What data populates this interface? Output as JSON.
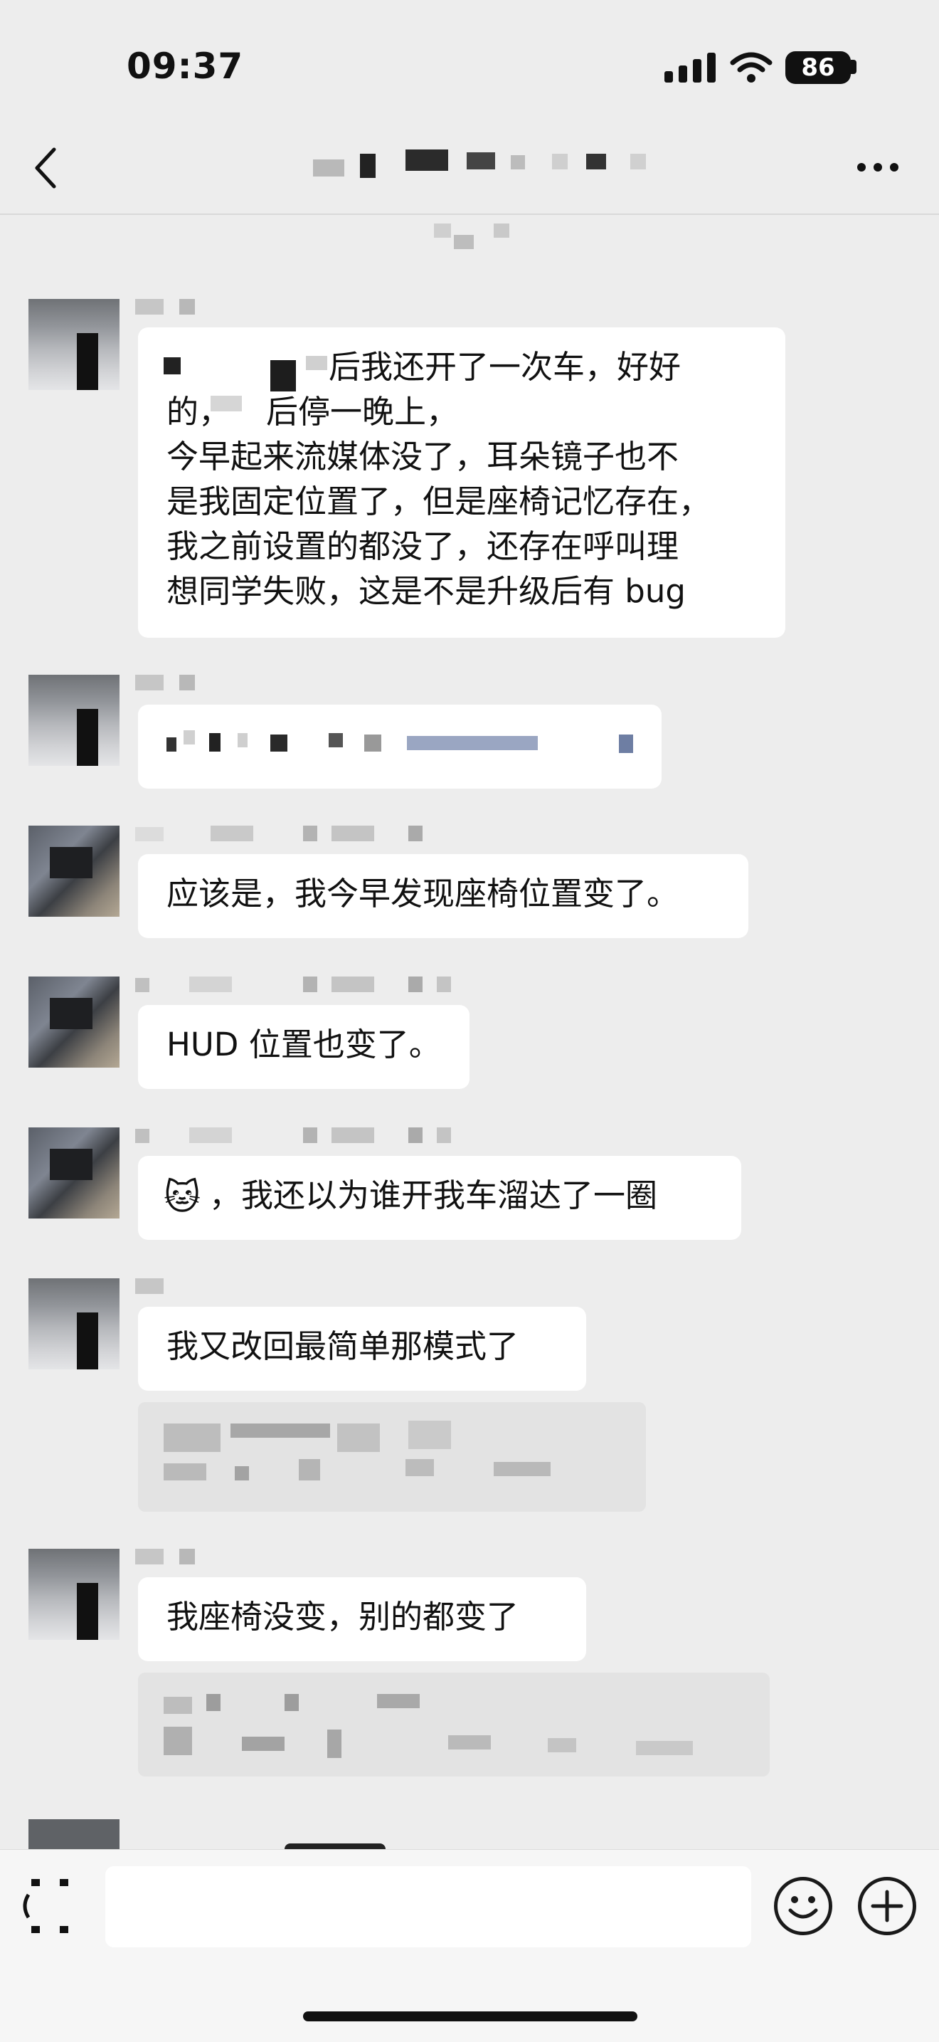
{
  "status_bar": {
    "time": "09:37",
    "battery": "86"
  },
  "nav": {
    "back_icon": "chevron-left-icon",
    "more_icon": "ellipsis-icon"
  },
  "messages": [
    {
      "text_line1": "后我还开了一次车，好好",
      "text_line2": "的，",
      "text_line2b": "后停一晚上，",
      "text_rest": "今早起来流媒体没了，耳朵镜子也不\n是我固定位置了，但是座椅记忆存在，\n我之前设置的都没了，还存在呼叫理\n想同学失败，这是不是升级后有 bug"
    },
    {
      "text": "应该是，我今早发现座椅位置变了。"
    },
    {
      "text": "HUD 位置也变了。"
    },
    {
      "emoji": "🐱",
      "text": "，我还以为谁开我车溜达了一圈"
    },
    {
      "text": "我又改回最简单那模式了"
    },
    {
      "text": "我座椅没变，别的都变了"
    }
  ],
  "input_bar": {
    "voice_icon": "voice-icon",
    "emoji_icon": "emoji-icon",
    "add_icon": "plus-icon"
  },
  "colors": {
    "background": "#ededed",
    "bubble": "#ffffff",
    "quote": "#e3e3e3",
    "text": "#111111"
  }
}
